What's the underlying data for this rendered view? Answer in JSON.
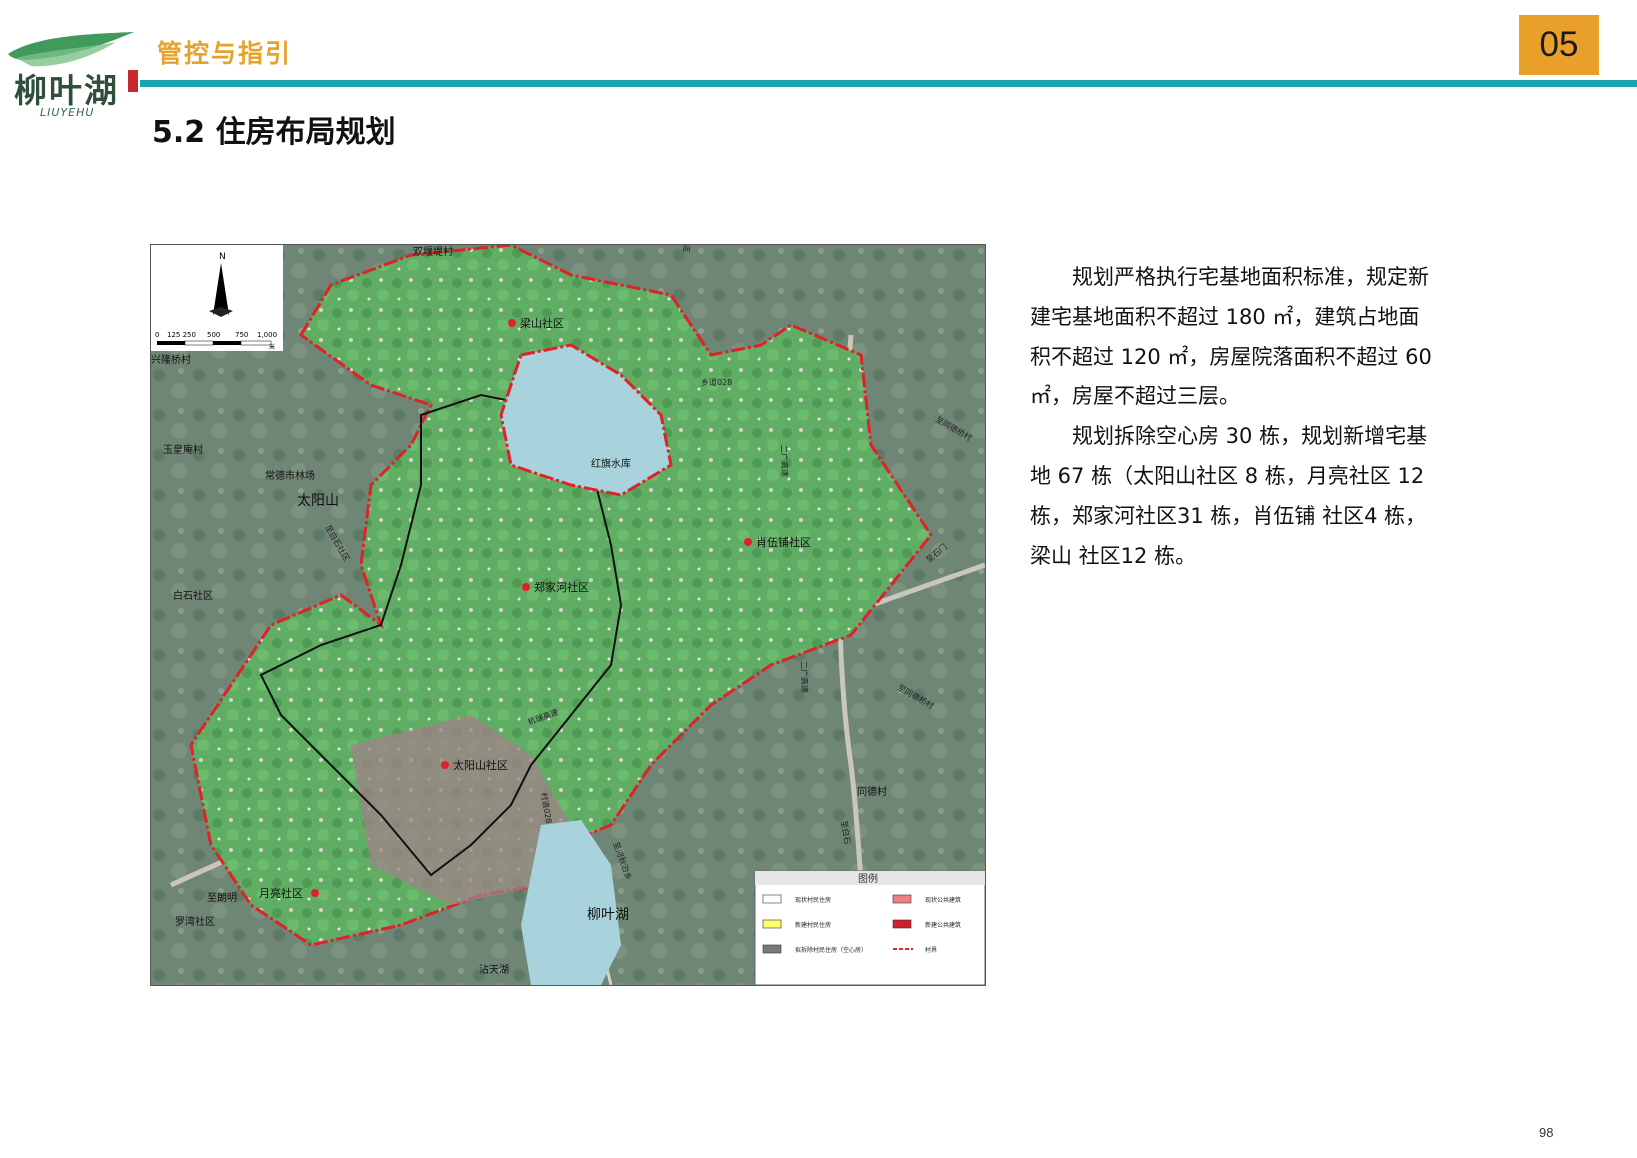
{
  "brand": {
    "logo_text": "柳叶湖",
    "logo_subtext": "LIUYEHU"
  },
  "header": {
    "section_title": "管控与指引",
    "chapter_number": "05"
  },
  "page": {
    "heading": "5.2 住房布局规划",
    "page_number": "98"
  },
  "map": {
    "scale_labels": [
      "0",
      "125 250",
      "500",
      "750",
      "1,000"
    ],
    "scale_unit": "米",
    "community_labels": [
      "梁山社区",
      "肖伍铺社区",
      "郑家河社区",
      "太阳山社区",
      "月亮社区"
    ],
    "place_labels": [
      "双堰堤村",
      "兴隆桥村",
      "玉皇庵村",
      "常德市林场",
      "太阳山",
      "白石社区",
      "红旗水库",
      "同德村",
      "柳叶湖",
      "罗湾社区",
      "沾天湖",
      "至朗明"
    ],
    "road_labels": [
      "至大龙站镇",
      "乡道028",
      "二广高速",
      "至同德桥村",
      "至石门",
      "至白石社区",
      "杭瑞高速",
      "村道028",
      "至同德桥村",
      "二广高速",
      "至河秋泊乡",
      "至白石"
    ],
    "legend": {
      "title": "图例",
      "items": [
        {
          "label": "现状村民住房",
          "color": "#ffffff"
        },
        {
          "label": "现状公共建筑",
          "color": "#f08080"
        },
        {
          "label": "新建村民住房",
          "color": "#ffff66"
        },
        {
          "label": "新建公共建筑",
          "color": "#d0202a"
        },
        {
          "label": "拟拆除村民住房（空心房）",
          "color": "#7a7a7a"
        },
        {
          "label": "村界",
          "color": "#e0202a"
        }
      ]
    },
    "colors": {
      "boundary": "#e0202a",
      "inner_boundary": "#111111",
      "green_area": "#5fae64",
      "lake": "#a9d3dc",
      "marker": "#e0202a"
    }
  },
  "body_paragraphs": [
    "规划严格执行宅基地面积标准，规定新建宅基地面积不超过 180 ㎡，建筑占地面积不超过 120 ㎡，房屋院落面积不超过 60 ㎡，房屋不超过三层。",
    "规划拆除空心房 30 栋，规划新增宅基地 67 栋（太阳山社区 8 栋，月亮社区 12 栋，郑家河社区31 栋，肖伍铺 社区4 栋，梁山 社区12 栋。"
  ]
}
